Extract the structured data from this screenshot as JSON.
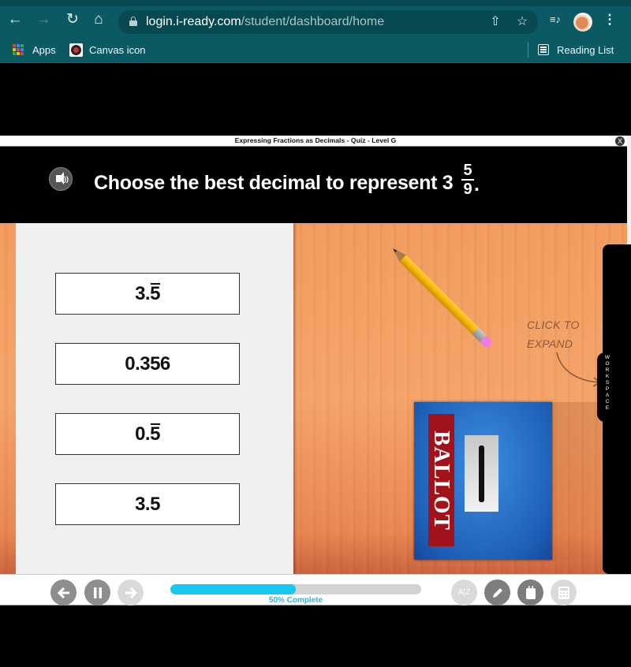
{
  "browser": {
    "nav": {
      "back": "back-arrow",
      "forward": "forward-arrow",
      "reload": "reload",
      "home": "home"
    },
    "url": {
      "host": "login.i-ready.com",
      "path": "/student/dashboard/home"
    },
    "omnibox_icons": [
      "share-icon",
      "bookmark-star-icon"
    ],
    "toolbar_icons": [
      "media-queue-icon",
      "profile-avatar",
      "menu-icon"
    ],
    "bookmarks": [
      {
        "label": "Apps",
        "icon": "apps-grid-icon"
      },
      {
        "label": "Canvas icon",
        "icon": "canvas-icon"
      }
    ],
    "reading_list": "Reading List",
    "glyphs": {
      "back": "←",
      "forward": "→",
      "reload": "↻",
      "home": "⌂",
      "share": "⇧",
      "star": "☆",
      "menu": "⋮",
      "queue": "≡♪"
    },
    "apps_colors": [
      "#e94235",
      "#4285f4",
      "#34a853",
      "#fbbc04",
      "#e94235",
      "#4285f4",
      "#34a853",
      "#fbbc04",
      "#e94235"
    ]
  },
  "quiz": {
    "title": "Expressing Fractions as Decimals - Quiz - Level G",
    "close_glyph": "X",
    "prompt": "Choose the best decimal to represent 3",
    "mixed_number": {
      "whole": "3",
      "numerator": "5",
      "denominator": "9"
    },
    "prompt_end": ".",
    "answers": [
      {
        "prefix": "3.",
        "repeating": "5",
        "plain": ""
      },
      {
        "prefix": "",
        "repeating": "",
        "plain": "0.356"
      },
      {
        "prefix": "0.",
        "repeating": "5",
        "plain": ""
      },
      {
        "prefix": "",
        "repeating": "",
        "plain": "3.5"
      }
    ],
    "hint": {
      "line1": "CLICK TO",
      "line2": "EXPAND"
    },
    "workspace_label": [
      "W",
      "O",
      "R",
      "K",
      "S",
      "P",
      "A",
      "C",
      "E"
    ],
    "ballot_label": "BALLOT"
  },
  "footer": {
    "progress_percent": 50,
    "progress_label": "50% Complete",
    "buttons": [
      "back-button",
      "pause-button",
      "next-button",
      "glossary-button",
      "pencil-button",
      "notepad-button",
      "calculator-button"
    ],
    "glossary_text": "A|Z"
  },
  "colors": {
    "chrome": "#0b5a63",
    "progress": "#17c7ef",
    "ballot_red": "#a2121a",
    "ballot_blue": "#1d5fb8"
  }
}
